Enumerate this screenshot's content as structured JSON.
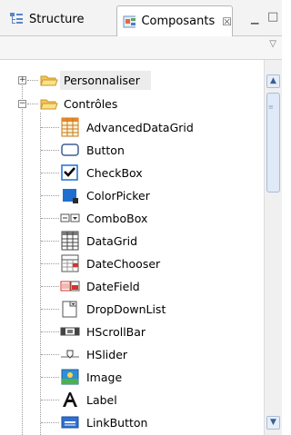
{
  "tabs": {
    "structure_label": "Structure",
    "composants_label": "Composants",
    "close_glyph": "☒"
  },
  "window_controls": {
    "minimize_glyph": "▁",
    "maximize_glyph": "□"
  },
  "view_menu_glyph": "▽",
  "tree": {
    "nodes": [
      {
        "label": "Personnaliser",
        "expanded": false,
        "selected": true
      },
      {
        "label": "Contrôles",
        "expanded": true,
        "selected": false
      }
    ],
    "controls": [
      {
        "label": "AdvancedDataGrid",
        "icon": "advanced-data-grid-icon"
      },
      {
        "label": "Button",
        "icon": "button-icon"
      },
      {
        "label": "CheckBox",
        "icon": "checkbox-icon"
      },
      {
        "label": "ColorPicker",
        "icon": "color-picker-icon"
      },
      {
        "label": "ComboBox",
        "icon": "combobox-icon"
      },
      {
        "label": "DataGrid",
        "icon": "data-grid-icon"
      },
      {
        "label": "DateChooser",
        "icon": "date-chooser-icon"
      },
      {
        "label": "DateField",
        "icon": "date-field-icon"
      },
      {
        "label": "DropDownList",
        "icon": "drop-down-list-icon"
      },
      {
        "label": "HScrollBar",
        "icon": "hscrollbar-icon"
      },
      {
        "label": "HSlider",
        "icon": "hslider-icon"
      },
      {
        "label": "Image",
        "icon": "image-icon"
      },
      {
        "label": "Label",
        "icon": "label-icon"
      },
      {
        "label": "LinkButton",
        "icon": "link-button-icon"
      }
    ]
  },
  "colors": {
    "folder": "#f3c84f",
    "selection": "#ececec",
    "accent": "#1f6fd0"
  }
}
